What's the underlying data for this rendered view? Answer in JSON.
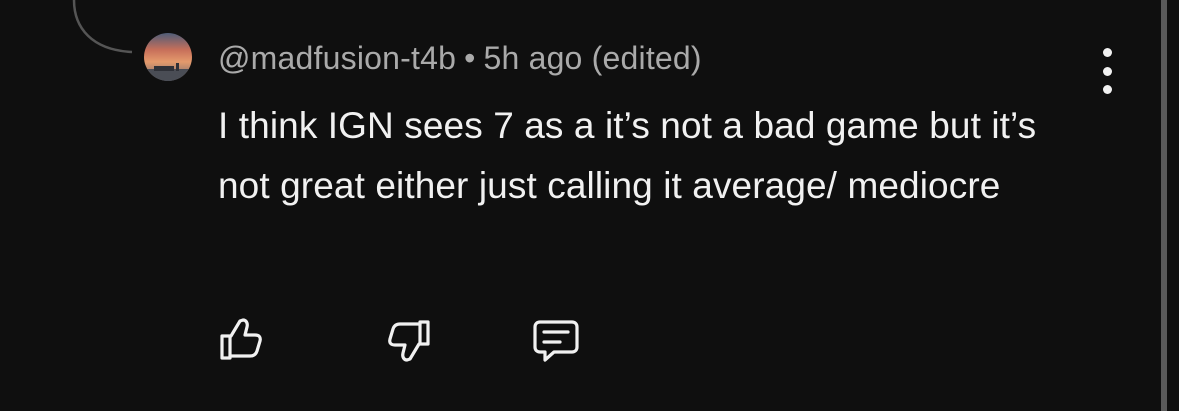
{
  "comment": {
    "author": "@madfusion-t4b",
    "separator": "•",
    "timestamp": "5h ago",
    "edited_label": "(edited)",
    "body": "I think IGN sees 7 as a it’s not a bad game but it’s not great either just calling it average/ mediocre"
  },
  "actions": {
    "like_icon": "thumbs-up-icon",
    "dislike_icon": "thumbs-down-icon",
    "reply_icon": "reply-comment-icon",
    "more_icon": "more-vertical-icon"
  },
  "colors": {
    "background": "#0f0f0f",
    "text_primary": "#f1f1f1",
    "text_secondary": "#aaaaaa",
    "thread_line": "#555555"
  }
}
